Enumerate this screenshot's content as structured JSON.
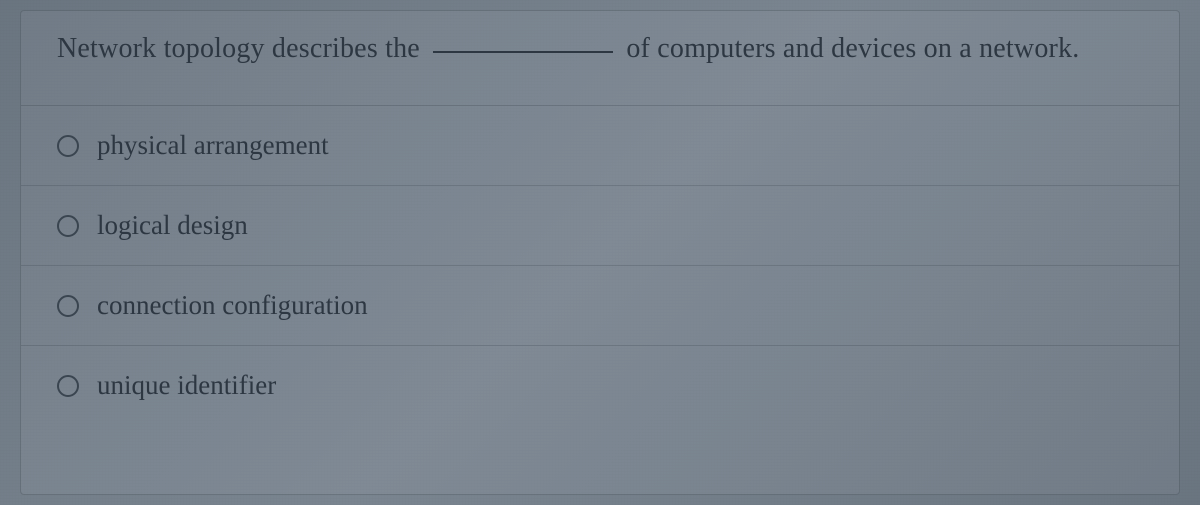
{
  "question": {
    "prefix": "Network topology describes the",
    "suffix": "of computers and devices on a network."
  },
  "options": [
    {
      "label": "physical arrangement"
    },
    {
      "label": "logical design"
    },
    {
      "label": "connection configuration"
    },
    {
      "label": "unique identifier"
    }
  ]
}
